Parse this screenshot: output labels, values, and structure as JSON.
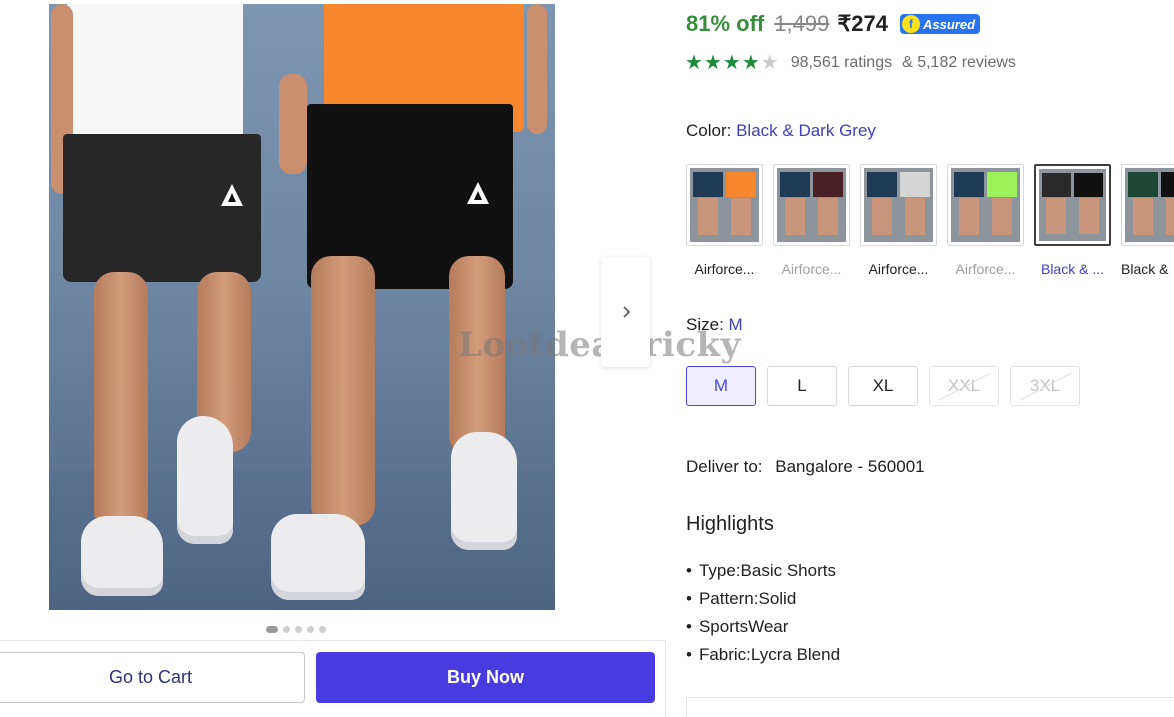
{
  "gallery": {
    "dots_count": 5,
    "active_dot": 0,
    "watermark": "Lootdealtricky"
  },
  "actions": {
    "cart_label": "Go to Cart",
    "buy_label": "Buy Now"
  },
  "pricing": {
    "discount": "81% off",
    "mrp": "1,499",
    "price": "₹274",
    "assured_label": "Assured",
    "assured_color": "#2874f0"
  },
  "rating": {
    "stars": 4,
    "max_stars": 5,
    "ratings_text": "98,561 ratings",
    "reviews_text": "& 5,182 reviews",
    "star_color": "#1e8a3c"
  },
  "color": {
    "label": "Color:",
    "value": "Black & Dark Grey",
    "options": [
      {
        "name": "Airforce...",
        "state": "available"
      },
      {
        "name": "Airforce...",
        "state": "faded"
      },
      {
        "name": "Airforce...",
        "state": "available"
      },
      {
        "name": "Airforce...",
        "state": "faded"
      },
      {
        "name": "Black & ...",
        "state": "selected"
      },
      {
        "name": "Black &",
        "state": "available"
      }
    ]
  },
  "size": {
    "label": "Size:",
    "value": "M",
    "options": [
      {
        "label": "M",
        "state": "selected"
      },
      {
        "label": "L",
        "state": "available"
      },
      {
        "label": "XL",
        "state": "available"
      },
      {
        "label": "XXL",
        "state": "disabled"
      },
      {
        "label": "3XL",
        "state": "disabled"
      }
    ]
  },
  "delivery": {
    "label": "Deliver to:",
    "location": "Bangalore - 560001"
  },
  "highlights": {
    "title": "Highlights",
    "items": [
      "Type:Basic Shorts",
      "Pattern:Solid",
      "SportsWear",
      "Fabric:Lycra Blend"
    ]
  },
  "colors": {
    "primary_button": "#4a3be0",
    "discount_green": "#388e3c",
    "link_blue": "#3f3fb8"
  }
}
